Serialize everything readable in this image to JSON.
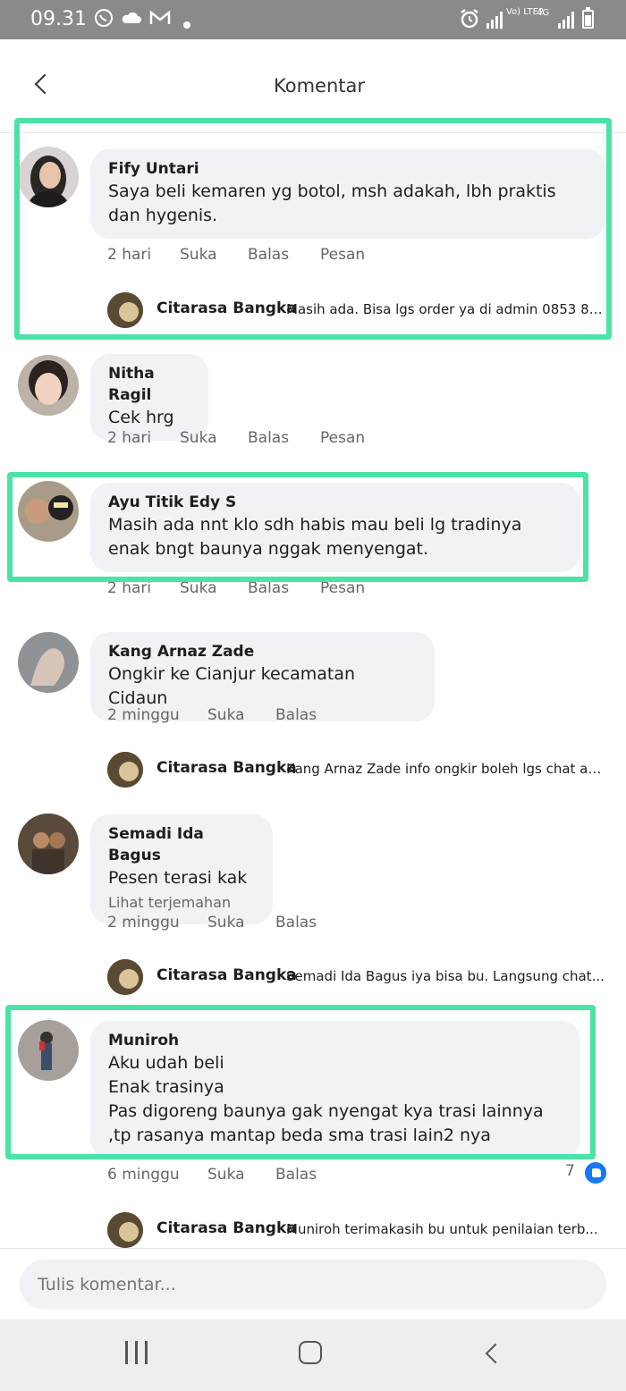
{
  "status_bar": {
    "time": "09.31",
    "network_label": "Vo) LTE2",
    "network_type": "4G"
  },
  "header": {
    "title": "Komentar"
  },
  "comments": [
    {
      "name": "Fify Untari",
      "text": "Saya beli kemaren yg botol, msh adakah, lbh praktis dan hygenis.",
      "time": "2 hari",
      "like": "Suka",
      "reply": "Balas",
      "message": "Pesan",
      "reply_preview": {
        "name": "Citarasa Bangka",
        "text": "Masih ada. Bisa lgs order ya di admin 0853 84..."
      }
    },
    {
      "name": "Nitha Ragil",
      "text": "Cek hrg",
      "time": "2 hari",
      "like": "Suka",
      "reply": "Balas",
      "message": "Pesan"
    },
    {
      "name": "Ayu Titik Edy S",
      "text": "Masih ada nnt klo sdh habis mau beli lg tradinya enak bngt baunya nggak menyengat.",
      "time": "2 hari",
      "like": "Suka",
      "reply": "Balas",
      "message": "Pesan"
    },
    {
      "name": "Kang Arnaz Zade",
      "text": "Ongkir ke Cianjur kecamatan Cidaun",
      "time": "2 minggu",
      "like": "Suka",
      "reply": "Balas",
      "reply_preview": {
        "name": "Citarasa Bangka",
        "text": "Kang Arnaz Zade info ongkir boleh lgs chat ad..."
      }
    },
    {
      "name": "Semadi Ida Bagus",
      "text": "Pesen terasi kak",
      "translate": "Lihat terjemahan",
      "time": "2 minggu",
      "like": "Suka",
      "reply": "Balas",
      "reply_preview": {
        "name": "Citarasa Bangka",
        "text": "Semadi Ida Bagus iya bisa bu. Langsung chat..."
      }
    },
    {
      "name": "Muniroh",
      "text": "Aku udah beli\nEnak trasinya\nPas digoreng baunya gak nyengat kya trasi lainnya  ,tp rasanya mantap beda sma trasi lain2 nya",
      "time": "6 minggu",
      "like": "Suka",
      "reply": "Balas",
      "like_count": "7",
      "reply_preview": {
        "name": "Citarasa Bangka",
        "text": "Muniroh terimakasih bu untuk penilaian terb..."
      }
    }
  ],
  "composer": {
    "placeholder": "Tulis komentar..."
  },
  "colors": {
    "highlight": "#4be3a6",
    "bubble": "#f0f2f5",
    "like_blue": "#1877f2"
  }
}
